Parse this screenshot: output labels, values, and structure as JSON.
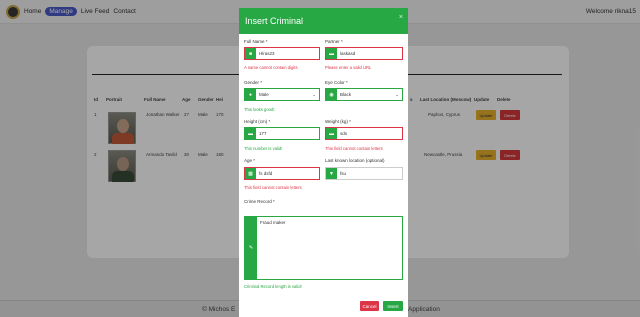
{
  "navbar": {
    "links": [
      "Home",
      "Manage",
      "Live Feed",
      "Contact"
    ],
    "welcome": "Welcome rikna15"
  },
  "table": {
    "headers": [
      "Id",
      "Portrait",
      "Full Name",
      "Age",
      "Gender",
      "Hei",
      "s",
      "Last Location (Moscow)",
      "Update",
      "Delete"
    ],
    "rows": [
      {
        "id": "1",
        "full_name": "Jonathan Walker",
        "age": "27",
        "gender": "Male",
        "height": "170",
        "last_location": "Paphos, Cyprus",
        "update": "Update",
        "delete": "Delete"
      },
      {
        "id": "2",
        "full_name": "Armando Tavild",
        "age": "30",
        "gender": "Male",
        "height": "180",
        "last_location": "Newcastle, Prussia",
        "update": "Update",
        "delete": "Delete"
      }
    ]
  },
  "footer": {
    "left": "© Michos E",
    "right": "e Application"
  },
  "modal": {
    "title": "Insert Criminal",
    "close": "×",
    "full_name": {
      "label": "Full Name *",
      "value": "Hlras23",
      "error": "A name cannot contain digits"
    },
    "partner": {
      "label": "Partner *",
      "value": "laskasd",
      "error": "Please enter a valid URL"
    },
    "gender": {
      "label": "Gender *",
      "value": "Male",
      "error": "This looks good!"
    },
    "eye_color": {
      "label": "Eye Color *",
      "value": "Black"
    },
    "height": {
      "label": "Height (cm) *",
      "value": "177",
      "error": "This number is valid!"
    },
    "weight": {
      "label": "Weight (kg) *",
      "value": "sds",
      "error": "This field cannot contain letters"
    },
    "age": {
      "label": "Age *",
      "value": "fs dsfd",
      "error": "This field cannot contain letters"
    },
    "last_known": {
      "label": "Last known location (optional)",
      "value": "fsu"
    },
    "crime_record": {
      "label": "Crime Record *",
      "value": "Fraud maker",
      "error": "Criminal Record length is valid!"
    },
    "cancel": "Cancel",
    "insert": "Insert"
  },
  "colors": {
    "primary_green": "#28a745",
    "error_red": "#dc3545",
    "nav_active": "#4a59c9",
    "update_yellow": "#e6b12b"
  }
}
